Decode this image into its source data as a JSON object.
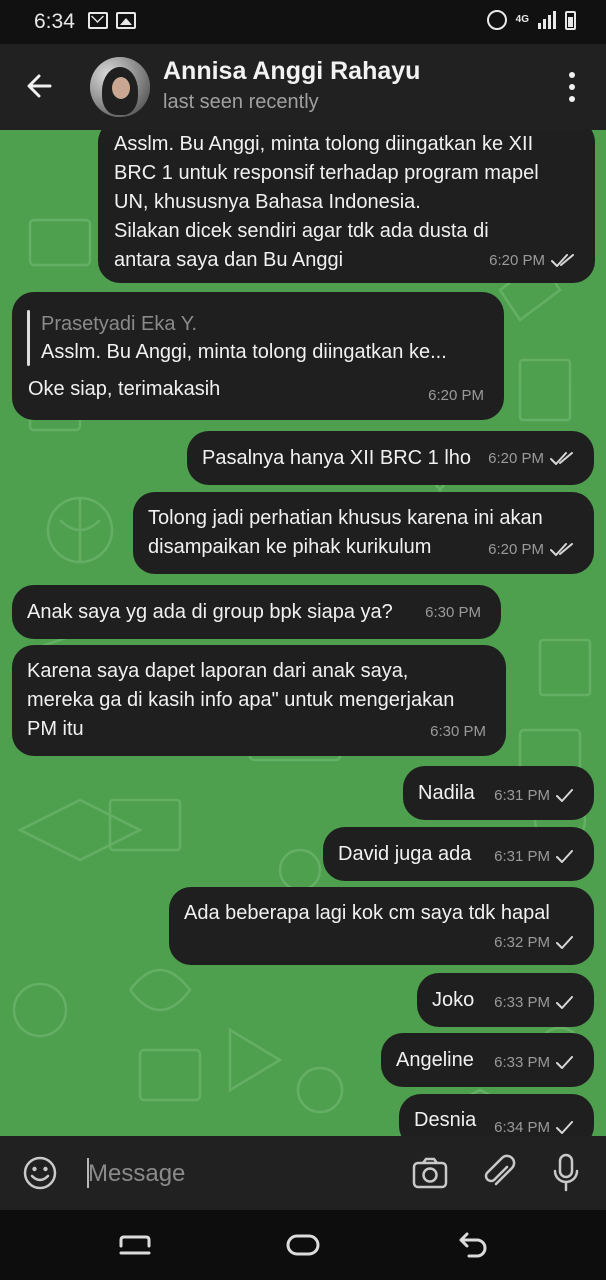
{
  "status_bar": {
    "time": "6:34",
    "network": "4G",
    "icons": [
      "mail-icon",
      "image-icon",
      "alarm-icon",
      "signal-icon",
      "battery-icon"
    ]
  },
  "header": {
    "contact_name": "Annisa Anggi Rahayu",
    "status": "last seen recently",
    "back_icon": "arrow-left-icon",
    "menu_icon": "more-vertical-icon"
  },
  "messages": [
    {
      "direction": "outgoing",
      "lines": [
        "Asslm. Bu Anggi, minta tolong diingatkan ke XII",
        "BRC 1 untuk responsif terhadap program mapel",
        "UN, khususnya Bahasa Indonesia.",
        "Silakan dicek sendiri agar tdk ada dusta di",
        "antara saya dan Bu Anggi"
      ],
      "time": "6:20 PM",
      "status": "read"
    },
    {
      "direction": "incoming",
      "quote": {
        "author": "Prasetyadi Eka Y.",
        "text": "Asslm. Bu Anggi, minta tolong diingatkan ke..."
      },
      "lines": [
        "Oke siap, terimakasih"
      ],
      "time": "6:20 PM"
    },
    {
      "direction": "outgoing",
      "lines": [
        "Pasalnya hanya XII BRC 1 lho"
      ],
      "time": "6:20 PM",
      "status": "read"
    },
    {
      "direction": "outgoing",
      "lines": [
        "Tolong jadi perhatian khusus karena ini akan",
        "disampaikan ke pihak kurikulum"
      ],
      "time": "6:20 PM",
      "status": "read"
    },
    {
      "direction": "incoming",
      "lines": [
        "Anak saya yg ada di group bpk siapa ya?"
      ],
      "time": "6:30 PM"
    },
    {
      "direction": "incoming",
      "lines": [
        "Karena saya dapet laporan dari anak saya,",
        "mereka ga di kasih info apa\" untuk mengerjakan",
        "PM itu"
      ],
      "time": "6:30 PM"
    },
    {
      "direction": "outgoing",
      "lines": [
        "Nadila"
      ],
      "time": "6:31 PM",
      "status": "sent"
    },
    {
      "direction": "outgoing",
      "lines": [
        "David juga ada"
      ],
      "time": "6:31 PM",
      "status": "sent"
    },
    {
      "direction": "outgoing",
      "lines": [
        "Ada beberapa lagi kok cm saya tdk hapal"
      ],
      "time": "6:32 PM",
      "status": "sent"
    },
    {
      "direction": "outgoing",
      "lines": [
        "Joko"
      ],
      "time": "6:33 PM",
      "status": "sent"
    },
    {
      "direction": "outgoing",
      "lines": [
        "Angeline"
      ],
      "time": "6:33 PM",
      "status": "sent"
    },
    {
      "direction": "outgoing",
      "lines": [
        "Desnia"
      ],
      "time": "6:34 PM",
      "status": "sent"
    }
  ],
  "composer": {
    "placeholder": "Message",
    "icons": [
      "emoji-icon",
      "camera-icon",
      "attach-icon",
      "microphone-icon"
    ]
  },
  "nav_bar": {
    "icons": [
      "recent-apps-icon",
      "home-icon",
      "back-nav-icon"
    ]
  },
  "colors": {
    "chat_background": "#4ea04f",
    "bubble": "#1f1f1f",
    "header": "#212121"
  }
}
